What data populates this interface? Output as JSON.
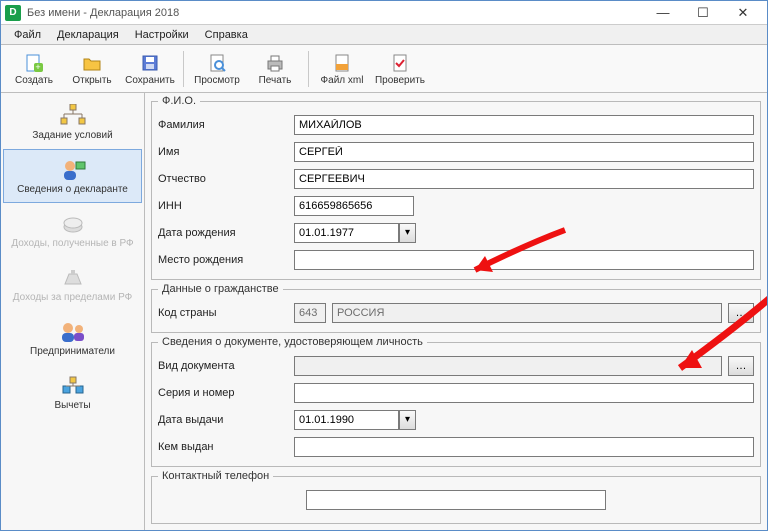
{
  "window": {
    "title": "Без имени - Декларация 2018"
  },
  "menu": {
    "file": "Файл",
    "declaration": "Декларация",
    "settings": "Настройки",
    "help": "Справка"
  },
  "toolbar": {
    "create": "Создать",
    "open": "Открыть",
    "save": "Сохранить",
    "preview": "Просмотр",
    "print": "Печать",
    "file_xml": "Файл xml",
    "check": "Проверить"
  },
  "sidebar": {
    "conditions": "Задание условий",
    "declarant": "Сведения о декларанте",
    "income_rf": "Доходы, полученные в РФ",
    "income_abroad": "Доходы за пределами РФ",
    "entrepreneurs": "Предприниматели",
    "deductions": "Вычеты"
  },
  "groups": {
    "fio": "Ф.И.О.",
    "citizenship": "Данные о гражданстве",
    "id_doc": "Сведения о документе, удостоверяющем личность",
    "phone": "Контактный телефон"
  },
  "labels": {
    "surname": "Фамилия",
    "name": "Имя",
    "patronymic": "Отчество",
    "inn": "ИНН",
    "birth_date": "Дата рождения",
    "birth_place": "Место рождения",
    "country_code": "Код страны",
    "doc_type": "Вид документа",
    "series_number": "Серия и номер",
    "issue_date": "Дата выдачи",
    "issued_by": "Кем выдан"
  },
  "values": {
    "surname": "МИХАЙЛОВ",
    "name": "СЕРГЕЙ",
    "patronymic": "СЕРГЕЕВИЧ",
    "inn": "616659865656",
    "birth_date": "01.01.1977",
    "birth_place": "",
    "country_code": "643",
    "country_name": "РОССИЯ",
    "doc_type": "",
    "series_number": "",
    "issue_date": "01.01.1990",
    "issued_by": "",
    "phone": ""
  }
}
